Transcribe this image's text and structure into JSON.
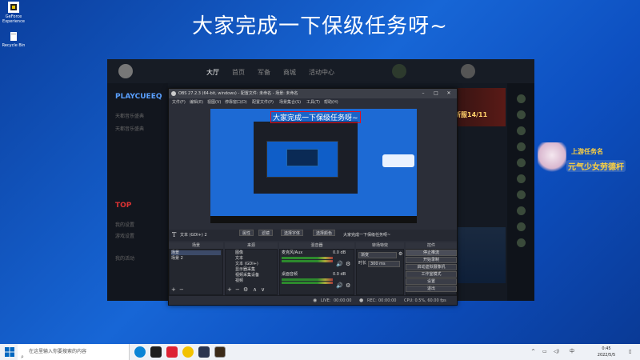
{
  "desktop": {
    "icons": [
      {
        "name": "GeForce Experience",
        "label": "GeForce Experience"
      },
      {
        "name": "Recycle Bin",
        "label": "Recycle Bin"
      }
    ]
  },
  "overlay_title": "大家完成一下保级任务呀~",
  "game_app": {
    "nav": [
      "大厅",
      "首页",
      "军备",
      "商城",
      "活动中心"
    ],
    "sidebar": [
      "PLAYCUEEQ",
      "天都音乐盛典",
      "天都音乐盛典",
      "TOP",
      "我的设置",
      "游戏设置",
      "我的活动"
    ],
    "promo_badge": "新服14/11"
  },
  "obs": {
    "title": "OBS 27.2.3 (64-bit, windows) - 配置文件: 未命名 - 场景: 未命名",
    "menu": [
      "文件(F)",
      "编辑(E)",
      "视图(V)",
      "停靠窗口(D)",
      "配置文件(P)",
      "场景集合(S)",
      "工具(T)",
      "帮助(H)"
    ],
    "preview_text": "大家完成一下保级任务呀~",
    "source_bar": {
      "current_source": "文本 (GDI+) 2",
      "properties_label": "属性",
      "filters_label": "滤镜",
      "font_label": "选择字体",
      "text_field_label": "选择颜色",
      "text_value": "大家完成一下保级任务呀~"
    },
    "docks": {
      "scenes_header": "场景",
      "sources_header": "来源",
      "mixer_header": "混音器",
      "transitions_header": "转场特效",
      "controls_header": "控件"
    },
    "scenes": [
      "场景",
      "场景 2"
    ],
    "sources": [
      "图像",
      "文本",
      "文本 (GDI+)",
      "显示器采集",
      "视频采集设备",
      "视频"
    ],
    "mixer": [
      {
        "name": "麦克风/Aux",
        "level": "0.0 dB"
      },
      {
        "name": "桌面音频",
        "level": "0.0 dB"
      }
    ],
    "transition": {
      "type": "渐变",
      "duration_label": "时长",
      "duration_value": "300 ms"
    },
    "controls": [
      "停止推流",
      "开始录制",
      "启动虚拟摄像机",
      "工作室模式",
      "设置",
      "退出"
    ],
    "status": {
      "live_label": "LIVE:",
      "live_time": "00:00:00",
      "rec_label": "REC:",
      "rec_time": "00:00:00",
      "cpu": "CPU: 0.5%, 60.00 fps"
    }
  },
  "mascot": {
    "line1": "上游任务名",
    "line2": "元气少女劳德杆"
  },
  "taskbar": {
    "search_placeholder": "在这里输入你要搜索的内容",
    "tray_lang": "中",
    "time": "0:45",
    "date": "2022/5/5"
  }
}
